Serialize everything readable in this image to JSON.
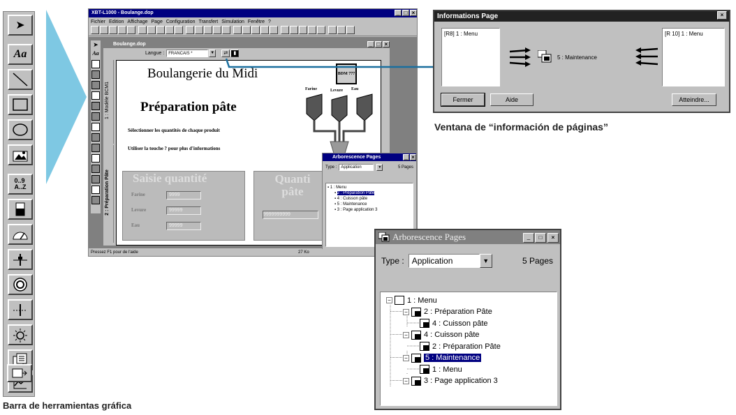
{
  "captions": {
    "toolbar": "Barra de herramientas gráfica",
    "info_window": "Ventana de “información de páginas”"
  },
  "main_window": {
    "title": "XBT-L1000 - Boulange.dop",
    "menu": [
      "Fichier",
      "Edition",
      "Affichage",
      "Page",
      "Configuration",
      "Transfert",
      "Simulation",
      "Fenêtre",
      "?"
    ],
    "doc_title": "Boulange.dop",
    "langue_label": "Langue :",
    "langue_value": "FRANCAIS *",
    "status_left": "Pressez F1 pour de l'aide",
    "status_right": "27 Ko",
    "vert_tab1": "1 : Modèle BCM1",
    "vert_tab2": "2 : Préparation Pâte",
    "page": {
      "heading": "Boulangerie du Midi",
      "subheading": "Préparation pâte",
      "line1": "Sélectionner les quantités de chaque produit",
      "line2": "Utiliser la touche ? pour plus d'informations",
      "silo_labels": [
        "Farine",
        "Levure",
        "Eau"
      ],
      "logo_text": "BDM 777",
      "saisie_title": "Saisie quantité",
      "fields": [
        {
          "label": "Farine",
          "value": "9999"
        },
        {
          "label": "Levure",
          "value": "99999"
        },
        {
          "label": "Eau",
          "value": "99999"
        }
      ],
      "quantite_title": "Quanti pâte",
      "quantite_value": "9999999999"
    },
    "mini_arbo": {
      "title": "Arborescence Pages",
      "type_label": "Type :",
      "type_value": "Application",
      "count": "5 Pages",
      "items": [
        "1 : Menu",
        "2 : Préparation Pâte",
        "4 : Cuisson pâte",
        "5 : Maintenance",
        "3 : Page application 3"
      ]
    }
  },
  "info_window": {
    "title": "Informations Page",
    "left_box": "[R8] 1 : Menu",
    "center_label": "5 : Maintenance",
    "right_box": "[R 10] 1 : Menu",
    "buttons": {
      "close": "Fermer",
      "help": "Aide",
      "goto": "Atteindre..."
    }
  },
  "arbo_window": {
    "title": "Arborescence Pages",
    "type_label": "Type :",
    "type_value": "Application",
    "count": "5 Pages",
    "tree": [
      {
        "label": "1 : Menu",
        "level": 0
      },
      {
        "label": "2 : Préparation Pâte",
        "level": 1
      },
      {
        "label": "4 : Cuisson pâte",
        "level": 2
      },
      {
        "label": "4 : Cuisson pâte",
        "level": 1
      },
      {
        "label": "2 : Préparation Pâte",
        "level": 2
      },
      {
        "label": "5 : Maintenance",
        "level": 1,
        "selected": true
      },
      {
        "label": "1 : Menu",
        "level": 2
      },
      {
        "label": "3 : Page application 3",
        "level": 1
      }
    ]
  },
  "colors": {
    "titlebar": "#000080",
    "triangle": "#7ec8e3",
    "arrow": "#1a6e9e",
    "selection": "#000080"
  }
}
